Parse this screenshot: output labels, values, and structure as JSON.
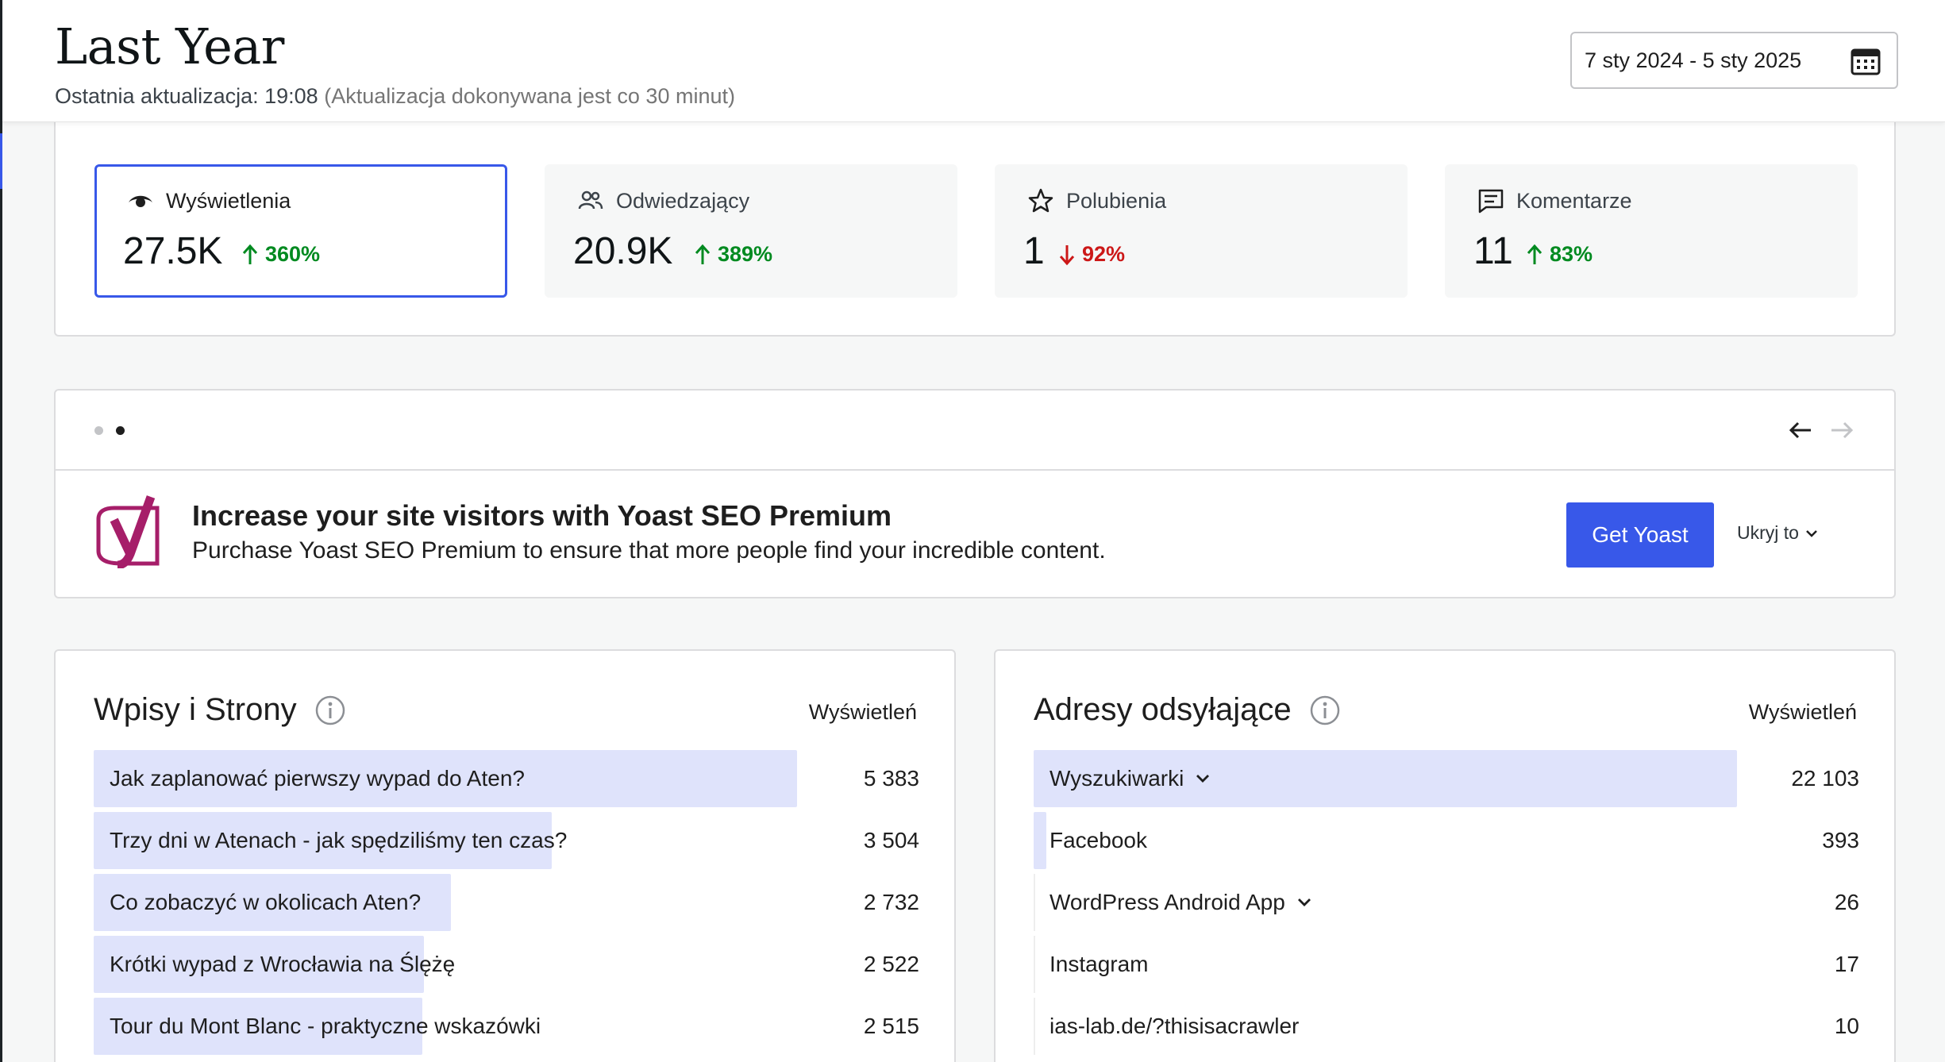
{
  "header": {
    "title": "Last Year",
    "last_update_label": "Ostatnia aktualizacja: 19:08",
    "last_update_note": "(Aktualizacja dokonywana jest co 30 minut)",
    "date_range": "7 sty 2024 - 5 sty 2025",
    "date_icon": "calendar-icon"
  },
  "stats": [
    {
      "label": "Wyświetlenia",
      "value": "27.5K",
      "delta": "360%",
      "direction": "up",
      "icon": "eye-icon",
      "active": true
    },
    {
      "label": "Odwiedzający",
      "value": "20.9K",
      "delta": "389%",
      "direction": "up",
      "icon": "people-icon",
      "active": false
    },
    {
      "label": "Polubienia",
      "value": "1",
      "delta": "92%",
      "direction": "down",
      "icon": "star-icon",
      "active": false
    },
    {
      "label": "Komentarze",
      "value": "11",
      "delta": "83%",
      "direction": "up",
      "icon": "comment-icon",
      "active": false
    }
  ],
  "promo": {
    "headline": "Increase your site visitors with Yoast SEO Premium",
    "subtext": "Purchase Yoast SEO Premium to ensure that more people find your incredible content.",
    "cta_label": "Get Yoast",
    "hide_label": "Ukryj to",
    "pagination": {
      "pages": 2,
      "current": 2
    }
  },
  "posts": {
    "title": "Wpisy i Strony",
    "column": "Wyświetleń",
    "rows": [
      {
        "label": "Jak zaplanować pierwszy wypad do Aten?",
        "value": "5 383",
        "share": 1.0
      },
      {
        "label": "Trzy dni w Atenach - jak spędziliśmy ten czas?",
        "value": "3 504",
        "share": 0.651
      },
      {
        "label": "Co zobaczyć w okolicach Aten?",
        "value": "2 732",
        "share": 0.508
      },
      {
        "label": "Krótki wypad z Wrocławia na Ślężę",
        "value": "2 522",
        "share": 0.469
      },
      {
        "label": "Tour du Mont Blanc - praktyczne wskazówki",
        "value": "2 515",
        "share": 0.467
      }
    ]
  },
  "referrers": {
    "title": "Adresy odsyłające",
    "column": "Wyświetleń",
    "rows": [
      {
        "label": "Wyszukiwarki",
        "value": "22 103",
        "share": 1.0,
        "expandable": true
      },
      {
        "label": "Facebook",
        "value": "393",
        "share": 0.018,
        "expandable": false
      },
      {
        "label": "WordPress Android App",
        "value": "26",
        "share": 0.001,
        "expandable": true
      },
      {
        "label": "Instagram",
        "value": "17",
        "share": 0.001,
        "expandable": false
      },
      {
        "label": "ias-lab.de/?thisisacrawler",
        "value": "10",
        "share": 0.0,
        "expandable": false
      }
    ]
  },
  "colors": {
    "accent": "#3858e9",
    "up": "#008a20",
    "down": "#cc1818",
    "bar": "#dfe3fb",
    "yoast": "#a61e69"
  }
}
